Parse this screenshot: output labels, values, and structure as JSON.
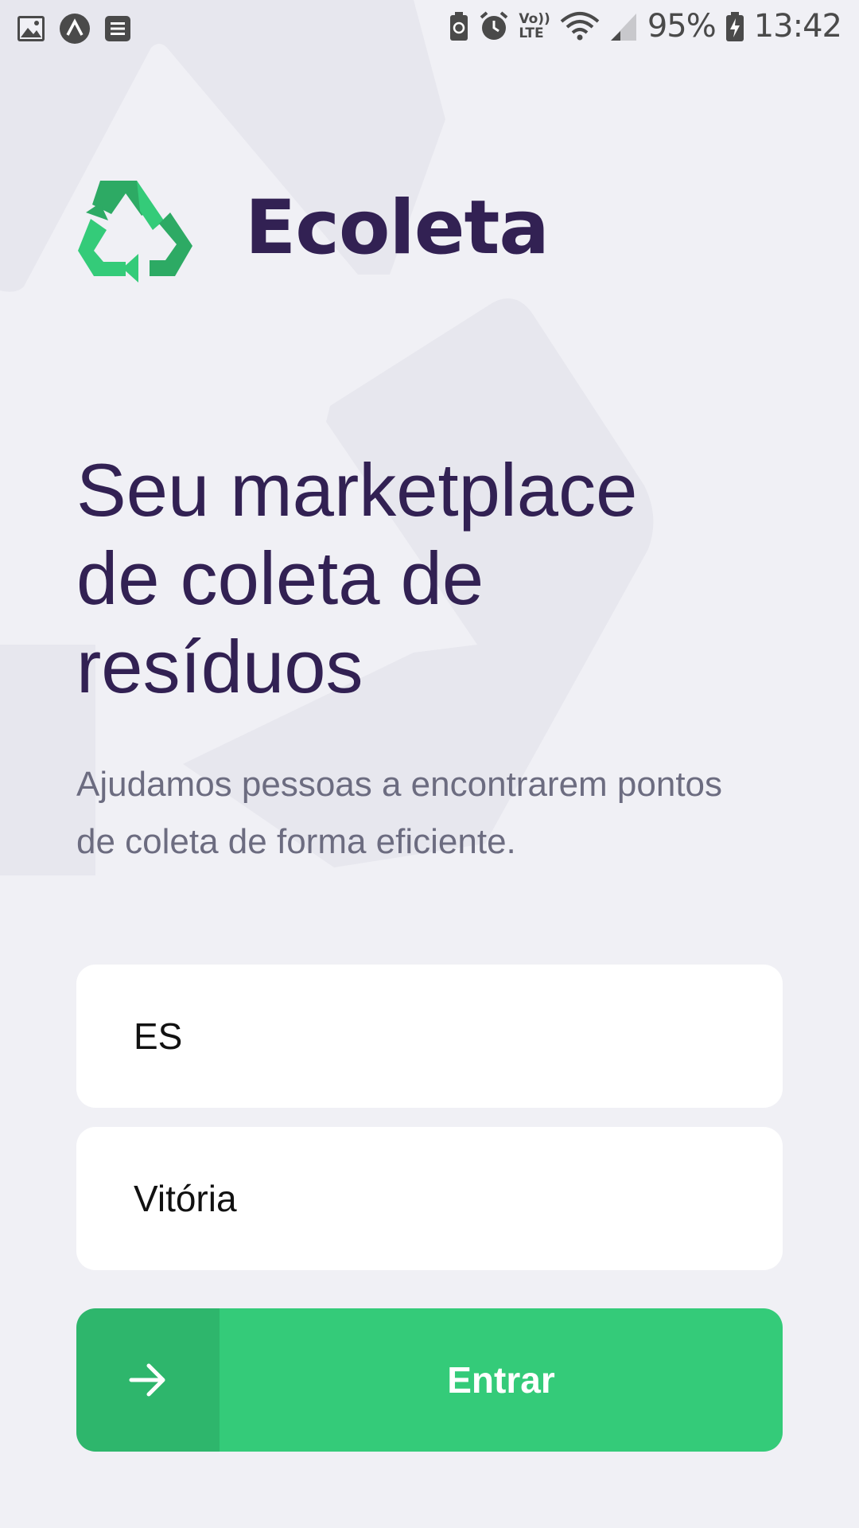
{
  "status_bar": {
    "battery_percent": "95%",
    "time": "13:42",
    "volte_label_top": "Vo))",
    "volte_label_bottom": "LTE",
    "left_icons": [
      "gallery-icon",
      "app-notification-icon",
      "notes-icon"
    ],
    "right_icons": [
      "battery-saver-icon",
      "alarm-icon",
      "volte-icon",
      "wifi-icon",
      "signal-icon",
      "battery-charging-icon"
    ]
  },
  "logo": {
    "icon": "recycle-icon",
    "brand_name": "Ecoleta"
  },
  "hero": {
    "title": "Seu marketplace de coleta de resíduos",
    "description": "Ajudamos pessoas a encontrarem pontos de coleta de forma eficiente."
  },
  "form": {
    "uf_value": "ES",
    "city_value": "Vitória"
  },
  "enter_button": {
    "label": "Entrar",
    "icon": "arrow-right-icon"
  },
  "colors": {
    "background": "#f0f0f5",
    "title": "#322153",
    "text": "#6c6c80",
    "primary_green": "#34cb79"
  }
}
